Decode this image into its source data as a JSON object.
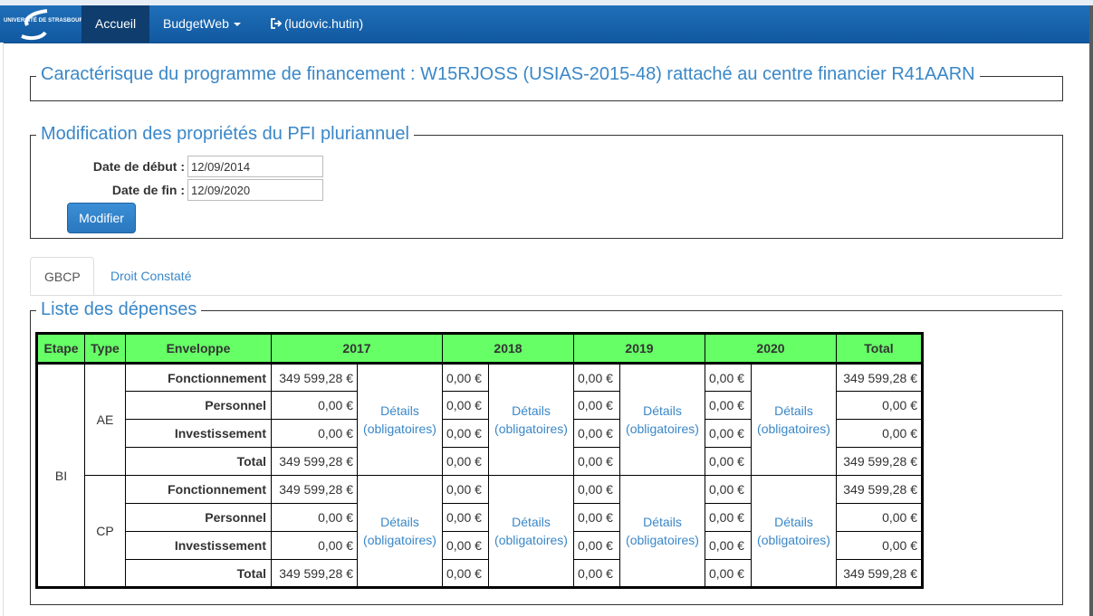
{
  "navbar": {
    "logo_text": "UNIVERSITÉ DE STRASBOURG",
    "items": [
      {
        "label": "Accueil",
        "active": true
      },
      {
        "label": "BudgetWeb",
        "dropdown": true
      },
      {
        "label": "(ludovic.hutin)",
        "icon": "logout-icon"
      }
    ]
  },
  "program": {
    "legend": "Caractérisque du programme de financement : W15RJOSS (USIAS-2015-48) rattaché au centre financier R41AARN"
  },
  "pfi_form": {
    "legend": "Modification des propriétés du PFI pluriannuel",
    "start_label": "Date de début :",
    "start_value": "12/09/2014",
    "end_label": "Date de fin :",
    "end_value": "12/09/2020",
    "submit_label": "Modifier"
  },
  "tabs": [
    {
      "label": "GBCP",
      "active": true
    },
    {
      "label": "Droit Constaté",
      "active": false
    }
  ],
  "expenses": {
    "legend": "Liste des dépenses",
    "headers": [
      "Etape",
      "Type",
      "Enveloppe",
      "2017",
      "2018",
      "2019",
      "2020",
      "Total"
    ],
    "etape": "BI",
    "details_label": "Détails",
    "details_sub": "(obligatoires)",
    "groups": [
      {
        "type": "AE",
        "rows": [
          {
            "enveloppe": "Fonctionnement",
            "y2017": "349 599,28 €",
            "y2018": "0,00 €",
            "y2019": "0,00 €",
            "y2020": "0,00 €",
            "total": "349 599,28 €"
          },
          {
            "enveloppe": "Personnel",
            "y2017": "0,00 €",
            "y2018": "0,00 €",
            "y2019": "0,00 €",
            "y2020": "0,00 €",
            "total": "0,00 €"
          },
          {
            "enveloppe": "Investissement",
            "y2017": "0,00 €",
            "y2018": "0,00 €",
            "y2019": "0,00 €",
            "y2020": "0,00 €",
            "total": "0,00 €"
          },
          {
            "enveloppe": "Total",
            "y2017": "349 599,28 €",
            "y2018": "0,00 €",
            "y2019": "0,00 €",
            "y2020": "0,00 €",
            "total": "349 599,28 €"
          }
        ]
      },
      {
        "type": "CP",
        "rows": [
          {
            "enveloppe": "Fonctionnement",
            "y2017": "349 599,28 €",
            "y2018": "0,00 €",
            "y2019": "0,00 €",
            "y2020": "0,00 €",
            "total": "349 599,28 €"
          },
          {
            "enveloppe": "Personnel",
            "y2017": "0,00 €",
            "y2018": "0,00 €",
            "y2019": "0,00 €",
            "y2020": "0,00 €",
            "total": "0,00 €"
          },
          {
            "enveloppe": "Investissement",
            "y2017": "0,00 €",
            "y2018": "0,00 €",
            "y2019": "0,00 €",
            "y2020": "0,00 €",
            "total": "0,00 €"
          },
          {
            "enveloppe": "Total",
            "y2017": "349 599,28 €",
            "y2018": "0,00 €",
            "y2019": "0,00 €",
            "y2020": "0,00 €",
            "total": "349 599,28 €"
          }
        ]
      }
    ]
  },
  "colors": {
    "navbar": "#1a65ad",
    "accent": "#3a87c8",
    "header_green": "#66ff66"
  }
}
